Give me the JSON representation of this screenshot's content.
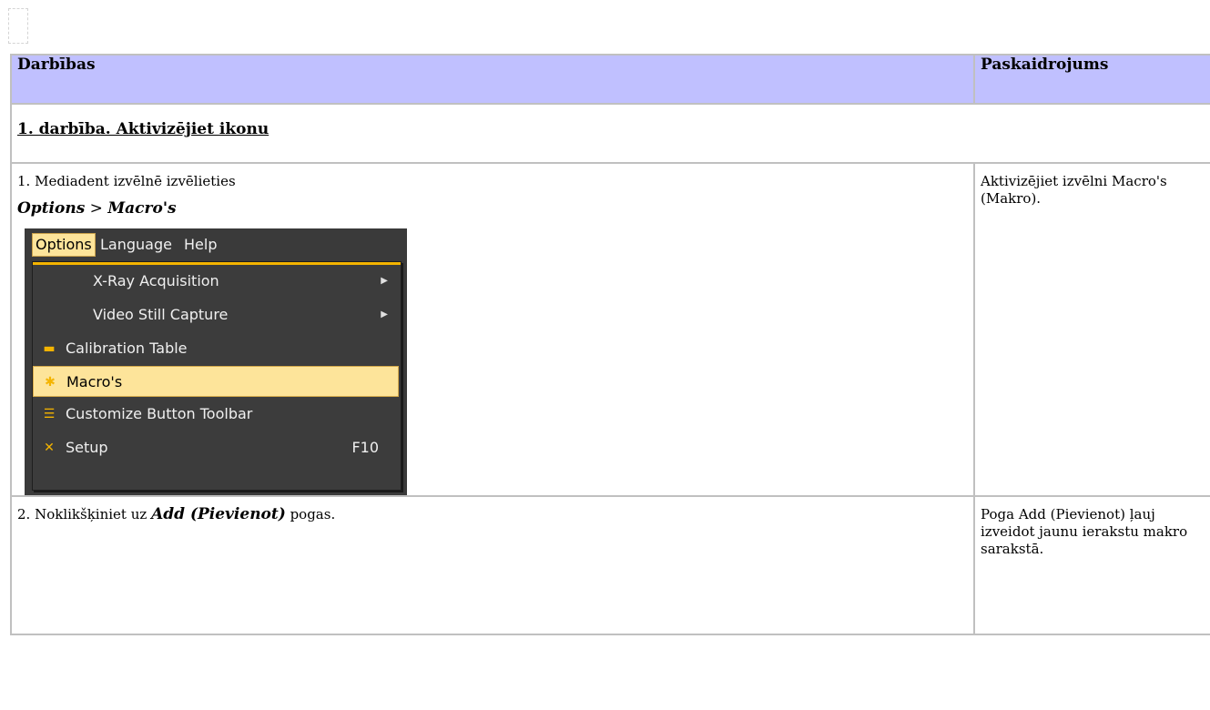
{
  "table": {
    "headers": {
      "actions": "Darbības",
      "explanation": "Paskaidrojums"
    },
    "section_title": "1. darbība. Aktivizējiet ikonu",
    "step1": {
      "text": "1. Mediadent izvēlnē izvēlieties",
      "path_a": "Options",
      "path_sep": " > ",
      "path_b": "Macro's",
      "explanation": "Aktivizējiet izvēlni Macro's (Makro)."
    },
    "step2": {
      "text_prefix": "2. Noklikšķiniet uz ",
      "text_bold": "Add (Pievienot)",
      "text_suffix": " pogas.",
      "explanation": "Poga Add (Pievienot) ļauj izveidot jaunu ierakstu makro sarakstā."
    }
  },
  "menu_screenshot": {
    "menubar": [
      "Options",
      "Language",
      "Help"
    ],
    "items": [
      {
        "label": "X-Ray Acquisition",
        "icon": "",
        "submenu": true
      },
      {
        "label": "Video Still Capture",
        "icon": "",
        "submenu": true
      },
      {
        "label": "Calibration Table",
        "icon": "ruler-icon"
      },
      {
        "label": "Macro's",
        "icon": "macro-icon",
        "highlighted": true
      },
      {
        "label": "Customize Button Toolbar",
        "icon": "hamburger-icon"
      },
      {
        "label": "Setup",
        "icon": "tools-icon",
        "shortcut": "F10"
      }
    ],
    "colors": {
      "menu_bg": "#3a3a3a",
      "highlight": "#fde49a",
      "accent": "#f4b400"
    }
  }
}
